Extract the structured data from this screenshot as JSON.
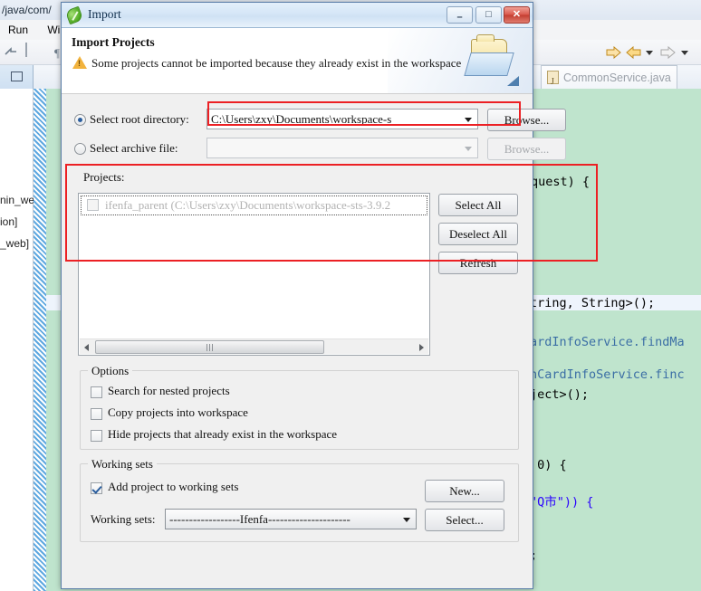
{
  "ide": {
    "titlebar_text": "/java/com/",
    "menu_items": [
      "Run",
      "Win"
    ],
    "editor_tab_label": "CommonService.java",
    "tree_items": [
      "nin_we",
      "ion]",
      "_web]"
    ],
    "icons": {
      "back_arrow": "back-arrow-icon",
      "forward_arrow": "forward-arrow-icon",
      "outline_view": "outline-view-icon",
      "paragraph": "paragraph-mark-icon"
    },
    "code_lines": [
      "quest) {",
      "tring, String>();",
      "ardInfoService.findMa",
      "hCardInfoService.finc",
      "ject>();",
      " 0) {",
      "\"Q市\")) {",
      ";"
    ],
    "editor_bg": "#bfe4cd"
  },
  "dialog": {
    "title": "Import",
    "title_icon": "spring-leaf-icon",
    "window_buttons": {
      "minimize": "–",
      "maximize": "□",
      "close": "✕"
    },
    "heading": "Import Projects",
    "message": "Some projects cannot be imported because they already exist in the workspace",
    "message_icon": "warning-icon",
    "banner_icon": "folder-icon",
    "source": {
      "root_dir_radio_label": "Select root directory:",
      "root_dir_value": "C:\\Users\\zxy\\Documents\\workspace-s",
      "root_dir_selected": true,
      "root_dir_browse_label": "Browse...",
      "archive_radio_label": "Select archive file:",
      "archive_value": "",
      "archive_selected": false,
      "archive_browse_label": "Browse..."
    },
    "projects": {
      "label": "Projects:",
      "items": [
        {
          "name": "ifenfa_parent (C:\\Users\\zxy\\Documents\\workspace-sts-3.9.2",
          "checked": false,
          "disabled": true
        }
      ],
      "select_all_label": "Select All",
      "deselect_all_label": "Deselect All",
      "refresh_label": "Refresh"
    },
    "options": {
      "group_title": "Options",
      "checkboxes": [
        {
          "label": "Search for nested projects",
          "checked": false
        },
        {
          "label": "Copy projects into workspace",
          "checked": false
        },
        {
          "label": "Hide projects that already exist in the workspace",
          "checked": false
        }
      ]
    },
    "working_sets": {
      "group_title": "Working sets",
      "add_checkbox_label": "Add project to working sets",
      "add_checked": true,
      "new_button_label": "New...",
      "sets_label": "Working sets:",
      "sets_value": "------------------Ifenfa---------------------",
      "select_button_label": "Select..."
    }
  },
  "annotations": {
    "highlight_color": "#ec2024",
    "boxes": [
      {
        "name": "root-directory-highlight"
      },
      {
        "name": "projects-area-highlight"
      }
    ]
  }
}
